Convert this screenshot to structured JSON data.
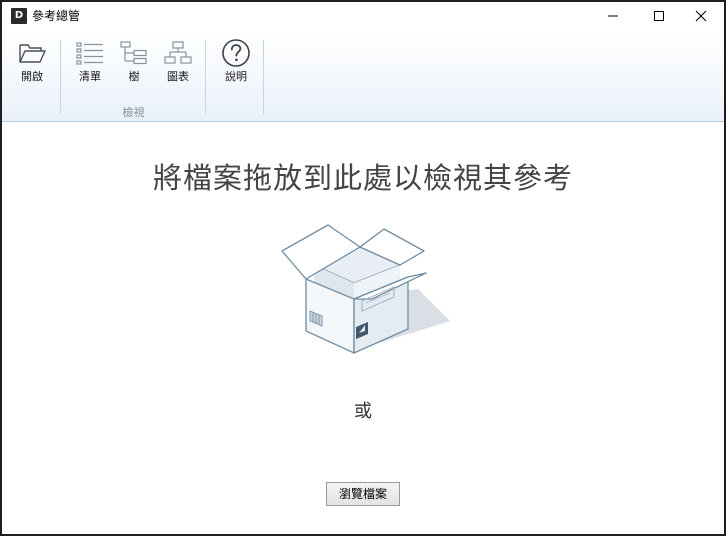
{
  "window": {
    "title": "參考總管",
    "app_icon_letter": "D"
  },
  "ribbon": {
    "open_label": "開啟",
    "list_label": "清單",
    "tree_label": "樹",
    "chart_label": "圖表",
    "help_label": "說明",
    "view_group_label": "檢視"
  },
  "main": {
    "headline": "將檔案拖放到此處以檢視其參考",
    "or_text": "或",
    "browse_label": "瀏覽檔案"
  },
  "icons": {
    "open": "folder-open-icon",
    "list": "list-icon",
    "tree": "tree-icon",
    "chart": "chart-icon",
    "help": "help-icon"
  }
}
